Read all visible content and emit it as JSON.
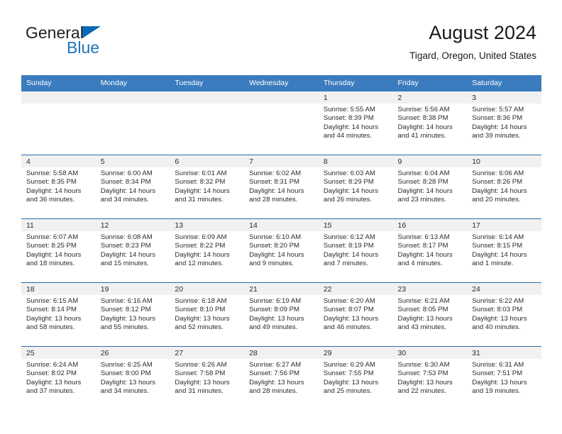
{
  "brand": {
    "name_part1": "General",
    "name_part2": "Blue",
    "triangle_color": "#0a69b4",
    "blue_color": "#1b75bb"
  },
  "header": {
    "title": "August 2024",
    "subtitle": "Tigard, Oregon, United States"
  },
  "colors": {
    "header_row_bg": "#3a7cbe",
    "row_divider": "#2e6da4",
    "daynum_band_bg": "#f1f1f1",
    "text": "#2b2b2b"
  },
  "weekday_headers": [
    "Sunday",
    "Monday",
    "Tuesday",
    "Wednesday",
    "Thursday",
    "Friday",
    "Saturday"
  ],
  "weeks": [
    [
      {
        "day": "",
        "empty": true
      },
      {
        "day": "",
        "empty": true
      },
      {
        "day": "",
        "empty": true
      },
      {
        "day": "",
        "empty": true
      },
      {
        "day": "1",
        "sunrise": "Sunrise: 5:55 AM",
        "sunset": "Sunset: 8:39 PM",
        "daylight1": "Daylight: 14 hours",
        "daylight2": "and 44 minutes."
      },
      {
        "day": "2",
        "sunrise": "Sunrise: 5:56 AM",
        "sunset": "Sunset: 8:38 PM",
        "daylight1": "Daylight: 14 hours",
        "daylight2": "and 41 minutes."
      },
      {
        "day": "3",
        "sunrise": "Sunrise: 5:57 AM",
        "sunset": "Sunset: 8:36 PM",
        "daylight1": "Daylight: 14 hours",
        "daylight2": "and 39 minutes."
      }
    ],
    [
      {
        "day": "4",
        "sunrise": "Sunrise: 5:58 AM",
        "sunset": "Sunset: 8:35 PM",
        "daylight1": "Daylight: 14 hours",
        "daylight2": "and 36 minutes."
      },
      {
        "day": "5",
        "sunrise": "Sunrise: 6:00 AM",
        "sunset": "Sunset: 8:34 PM",
        "daylight1": "Daylight: 14 hours",
        "daylight2": "and 34 minutes."
      },
      {
        "day": "6",
        "sunrise": "Sunrise: 6:01 AM",
        "sunset": "Sunset: 8:32 PM",
        "daylight1": "Daylight: 14 hours",
        "daylight2": "and 31 minutes."
      },
      {
        "day": "7",
        "sunrise": "Sunrise: 6:02 AM",
        "sunset": "Sunset: 8:31 PM",
        "daylight1": "Daylight: 14 hours",
        "daylight2": "and 28 minutes."
      },
      {
        "day": "8",
        "sunrise": "Sunrise: 6:03 AM",
        "sunset": "Sunset: 8:29 PM",
        "daylight1": "Daylight: 14 hours",
        "daylight2": "and 26 minutes."
      },
      {
        "day": "9",
        "sunrise": "Sunrise: 6:04 AM",
        "sunset": "Sunset: 8:28 PM",
        "daylight1": "Daylight: 14 hours",
        "daylight2": "and 23 minutes."
      },
      {
        "day": "10",
        "sunrise": "Sunrise: 6:06 AM",
        "sunset": "Sunset: 8:26 PM",
        "daylight1": "Daylight: 14 hours",
        "daylight2": "and 20 minutes."
      }
    ],
    [
      {
        "day": "11",
        "sunrise": "Sunrise: 6:07 AM",
        "sunset": "Sunset: 8:25 PM",
        "daylight1": "Daylight: 14 hours",
        "daylight2": "and 18 minutes."
      },
      {
        "day": "12",
        "sunrise": "Sunrise: 6:08 AM",
        "sunset": "Sunset: 8:23 PM",
        "daylight1": "Daylight: 14 hours",
        "daylight2": "and 15 minutes."
      },
      {
        "day": "13",
        "sunrise": "Sunrise: 6:09 AM",
        "sunset": "Sunset: 8:22 PM",
        "daylight1": "Daylight: 14 hours",
        "daylight2": "and 12 minutes."
      },
      {
        "day": "14",
        "sunrise": "Sunrise: 6:10 AM",
        "sunset": "Sunset: 8:20 PM",
        "daylight1": "Daylight: 14 hours",
        "daylight2": "and 9 minutes."
      },
      {
        "day": "15",
        "sunrise": "Sunrise: 6:12 AM",
        "sunset": "Sunset: 8:19 PM",
        "daylight1": "Daylight: 14 hours",
        "daylight2": "and 7 minutes."
      },
      {
        "day": "16",
        "sunrise": "Sunrise: 6:13 AM",
        "sunset": "Sunset: 8:17 PM",
        "daylight1": "Daylight: 14 hours",
        "daylight2": "and 4 minutes."
      },
      {
        "day": "17",
        "sunrise": "Sunrise: 6:14 AM",
        "sunset": "Sunset: 8:15 PM",
        "daylight1": "Daylight: 14 hours",
        "daylight2": "and 1 minute."
      }
    ],
    [
      {
        "day": "18",
        "sunrise": "Sunrise: 6:15 AM",
        "sunset": "Sunset: 8:14 PM",
        "daylight1": "Daylight: 13 hours",
        "daylight2": "and 58 minutes."
      },
      {
        "day": "19",
        "sunrise": "Sunrise: 6:16 AM",
        "sunset": "Sunset: 8:12 PM",
        "daylight1": "Daylight: 13 hours",
        "daylight2": "and 55 minutes."
      },
      {
        "day": "20",
        "sunrise": "Sunrise: 6:18 AM",
        "sunset": "Sunset: 8:10 PM",
        "daylight1": "Daylight: 13 hours",
        "daylight2": "and 52 minutes."
      },
      {
        "day": "21",
        "sunrise": "Sunrise: 6:19 AM",
        "sunset": "Sunset: 8:09 PM",
        "daylight1": "Daylight: 13 hours",
        "daylight2": "and 49 minutes."
      },
      {
        "day": "22",
        "sunrise": "Sunrise: 6:20 AM",
        "sunset": "Sunset: 8:07 PM",
        "daylight1": "Daylight: 13 hours",
        "daylight2": "and 46 minutes."
      },
      {
        "day": "23",
        "sunrise": "Sunrise: 6:21 AM",
        "sunset": "Sunset: 8:05 PM",
        "daylight1": "Daylight: 13 hours",
        "daylight2": "and 43 minutes."
      },
      {
        "day": "24",
        "sunrise": "Sunrise: 6:22 AM",
        "sunset": "Sunset: 8:03 PM",
        "daylight1": "Daylight: 13 hours",
        "daylight2": "and 40 minutes."
      }
    ],
    [
      {
        "day": "25",
        "sunrise": "Sunrise: 6:24 AM",
        "sunset": "Sunset: 8:02 PM",
        "daylight1": "Daylight: 13 hours",
        "daylight2": "and 37 minutes."
      },
      {
        "day": "26",
        "sunrise": "Sunrise: 6:25 AM",
        "sunset": "Sunset: 8:00 PM",
        "daylight1": "Daylight: 13 hours",
        "daylight2": "and 34 minutes."
      },
      {
        "day": "27",
        "sunrise": "Sunrise: 6:26 AM",
        "sunset": "Sunset: 7:58 PM",
        "daylight1": "Daylight: 13 hours",
        "daylight2": "and 31 minutes."
      },
      {
        "day": "28",
        "sunrise": "Sunrise: 6:27 AM",
        "sunset": "Sunset: 7:56 PM",
        "daylight1": "Daylight: 13 hours",
        "daylight2": "and 28 minutes."
      },
      {
        "day": "29",
        "sunrise": "Sunrise: 6:29 AM",
        "sunset": "Sunset: 7:55 PM",
        "daylight1": "Daylight: 13 hours",
        "daylight2": "and 25 minutes."
      },
      {
        "day": "30",
        "sunrise": "Sunrise: 6:30 AM",
        "sunset": "Sunset: 7:53 PM",
        "daylight1": "Daylight: 13 hours",
        "daylight2": "and 22 minutes."
      },
      {
        "day": "31",
        "sunrise": "Sunrise: 6:31 AM",
        "sunset": "Sunset: 7:51 PM",
        "daylight1": "Daylight: 13 hours",
        "daylight2": "and 19 minutes."
      }
    ]
  ]
}
